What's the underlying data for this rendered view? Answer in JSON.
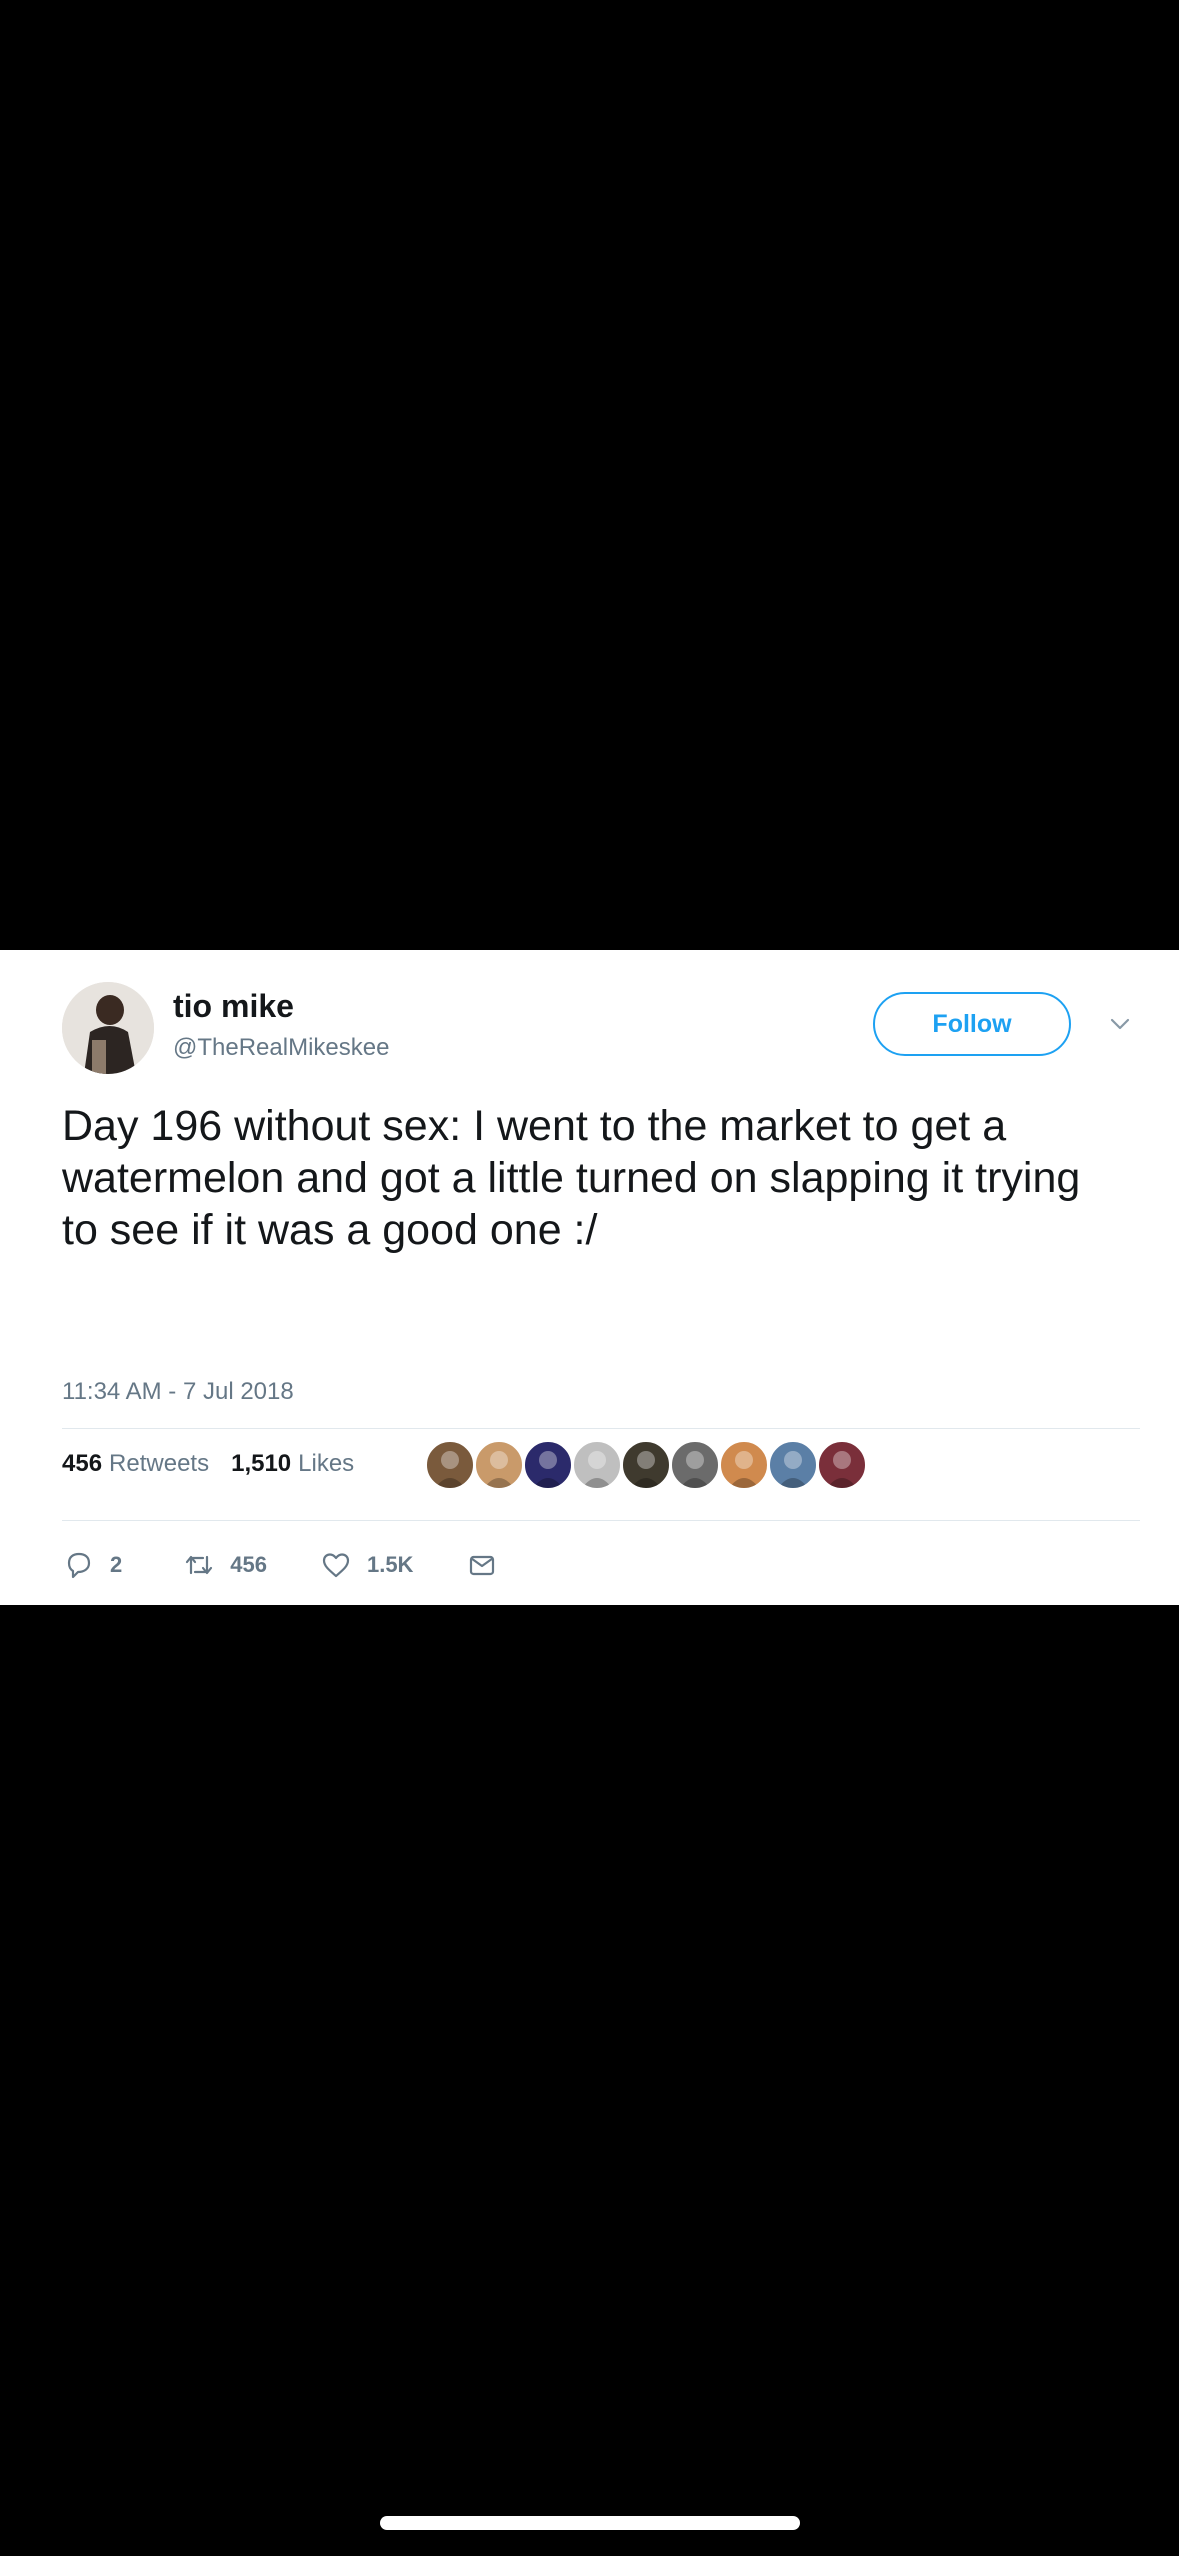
{
  "tweet": {
    "display_name": "tio mike",
    "handle": "@TheRealMikeskee",
    "follow_label": "Follow",
    "text": "Day 196 without sex: I went to the market to get a watermelon and got a little turned on slapping it trying to see if it was a good one :/",
    "timestamp": "11:34 AM - 7 Jul 2018",
    "retweets_count": "456",
    "retweets_label": "Retweets",
    "likes_count": "1,510",
    "likes_label": "Likes",
    "reply_count": "2",
    "retweet_action_count": "456",
    "like_action_count": "1.5K"
  },
  "colors": {
    "accent": "#1da1f2",
    "text": "#14171a",
    "secondary": "#657786",
    "divider": "#e1e8ed",
    "background": "#000000"
  },
  "likers": [
    {
      "icon": "liker-avatar",
      "color": "#7a5a3c"
    },
    {
      "icon": "liker-avatar",
      "color": "#c99a6a"
    },
    {
      "icon": "liker-avatar",
      "color": "#2b2a6b"
    },
    {
      "icon": "liker-avatar",
      "color": "#bfbfbf"
    },
    {
      "icon": "liker-avatar",
      "color": "#3f3a2e"
    },
    {
      "icon": "liker-avatar",
      "color": "#6b6b6b"
    },
    {
      "icon": "liker-avatar",
      "color": "#d08a4e"
    },
    {
      "icon": "liker-avatar",
      "color": "#5b7fa6"
    },
    {
      "icon": "liker-avatar",
      "color": "#7a2f3a"
    }
  ]
}
